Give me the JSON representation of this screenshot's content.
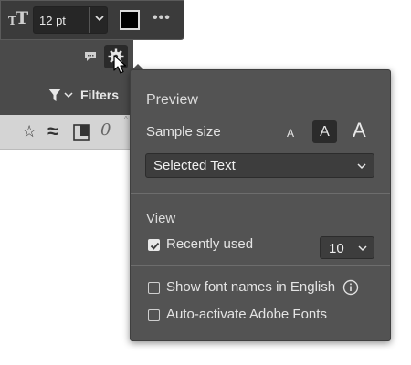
{
  "toolbar": {
    "text_icon": "text-size-icon",
    "font_size": "12 pt",
    "color_swatch": "#000000",
    "more_icon": "more-icon"
  },
  "panel": {
    "filters_label": "Filters",
    "icons": [
      "chat-icon",
      "gear-icon",
      "funnel-icon",
      "star-icon",
      "similar-icon",
      "document-icon",
      "italic-o-icon"
    ]
  },
  "popup": {
    "preview": {
      "title": "Preview",
      "sample_size_label": "Sample size",
      "sizes": [
        "A",
        "A",
        "A"
      ],
      "selected_size_index": 1,
      "preview_text_option": "Selected Text"
    },
    "view": {
      "title": "View",
      "recently_used_label": "Recently used",
      "recently_used_checked": true,
      "recently_used_count": "10"
    },
    "options": {
      "english_names_label": "Show font names in English",
      "english_names_checked": false,
      "auto_activate_label": "Auto-activate Adobe Fonts",
      "auto_activate_checked": false
    }
  },
  "colors": {
    "toolbar_bg": "#3b3b3b",
    "panel_bg": "#4a4a4a",
    "popup_bg": "#535353",
    "field_bg": "#3d3d3d"
  }
}
